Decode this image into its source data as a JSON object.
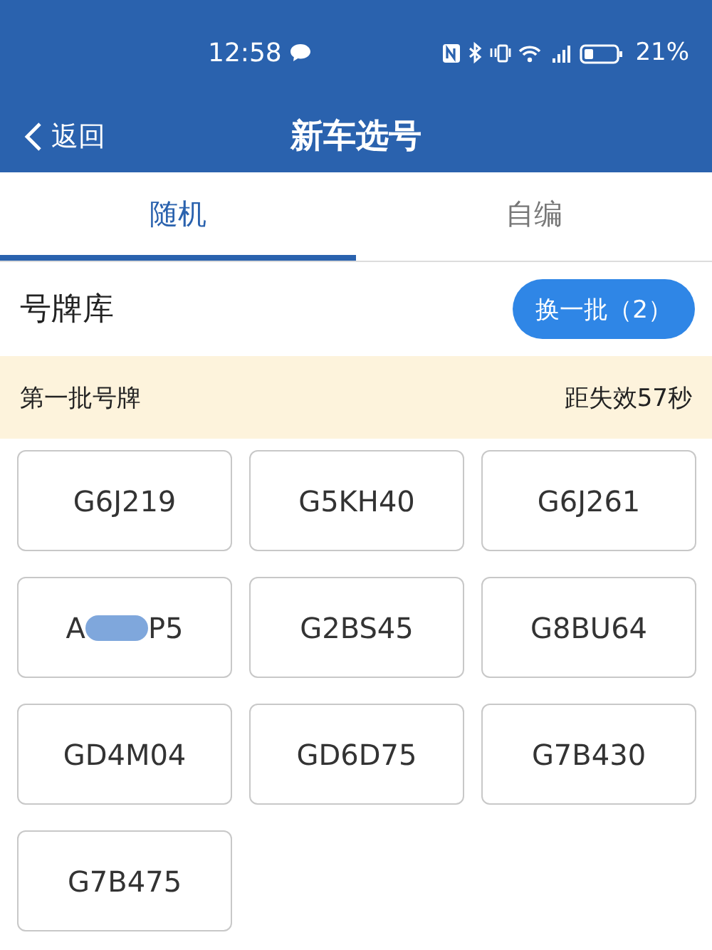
{
  "status_bar": {
    "time": "12:58",
    "battery": "21%"
  },
  "nav": {
    "back": "返回",
    "title": "新车选号"
  },
  "tabs": [
    {
      "label": "随机",
      "selected": true
    },
    {
      "label": "自编",
      "selected": false
    }
  ],
  "section": {
    "title": "号牌库",
    "button": "换一批（2）"
  },
  "banner": {
    "batch": "第一批号牌",
    "countdown": "距失效57秒"
  },
  "plates": [
    {
      "kind": "plain",
      "text": "G6J219"
    },
    {
      "kind": "plain",
      "text": "G5KH40"
    },
    {
      "kind": "plain",
      "text": "G6J261"
    },
    {
      "kind": "redacted",
      "start": "A",
      "end": "P5"
    },
    {
      "kind": "plain",
      "text": "G2BS45"
    },
    {
      "kind": "plain",
      "text": "G8BU64"
    },
    {
      "kind": "plain",
      "text": "GD4M04"
    },
    {
      "kind": "plain",
      "text": "GD6D75"
    },
    {
      "kind": "plain",
      "text": "G7B430"
    },
    {
      "kind": "plain",
      "text": "G7B475"
    }
  ]
}
